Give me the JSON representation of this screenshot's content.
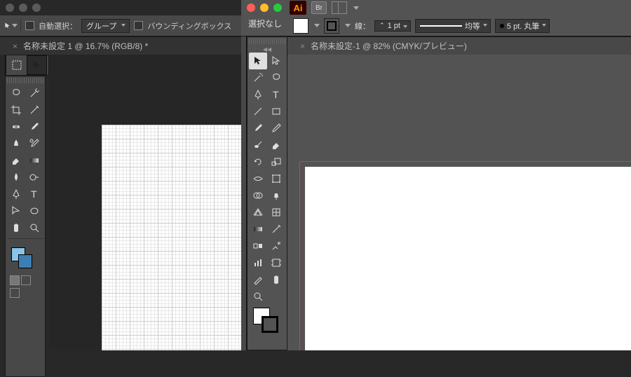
{
  "ps": {
    "options": {
      "auto_select_label": "自動選択：",
      "group_dd": "グループ",
      "bounding_label": "バウンディングボックス"
    },
    "tab": {
      "title": "名称未設定 1 @ 16.7% (RGB/8) *"
    }
  },
  "ai": {
    "logo": "Ai",
    "br": "Br",
    "selection_label": "選択なし",
    "options": {
      "stroke_label": "線：",
      "stroke_weight": "1 pt",
      "stroke_profile": "均等",
      "brush": "5 pt. 丸筆"
    },
    "tab": {
      "title": "名称未設定-1 @ 82% (CMYK/プレビュー)"
    }
  }
}
